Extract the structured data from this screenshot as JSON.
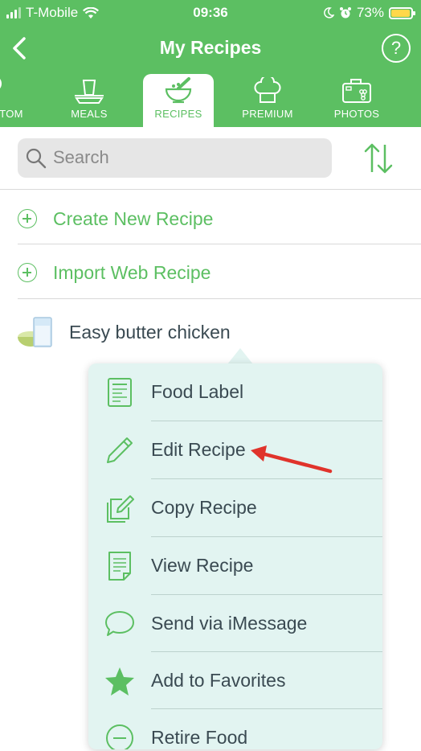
{
  "status_bar": {
    "carrier": "T-Mobile",
    "time": "09:36",
    "battery_percent": "73%"
  },
  "nav": {
    "title": "My Recipes",
    "help_label": "?"
  },
  "tabs": [
    {
      "label": "TOM",
      "icon": "spoon-icon",
      "active": false
    },
    {
      "label": "MEALS",
      "icon": "meals-icon",
      "active": false
    },
    {
      "label": "RECIPES",
      "icon": "mortar-pestle-icon",
      "active": true
    },
    {
      "label": "PREMIUM",
      "icon": "chef-hat-icon",
      "active": false
    },
    {
      "label": "PHOTOS",
      "icon": "camera-grapes-icon",
      "active": false
    }
  ],
  "search": {
    "placeholder": "Search"
  },
  "actions": {
    "create": "Create New Recipe",
    "import": "Import Web Recipe"
  },
  "recipe": {
    "name": "Easy butter chicken"
  },
  "menu": {
    "items": [
      {
        "label": "Food Label",
        "icon": "food-label-icon"
      },
      {
        "label": "Edit Recipe",
        "icon": "pencil-icon"
      },
      {
        "label": "Copy Recipe",
        "icon": "copy-edit-icon"
      },
      {
        "label": "View Recipe",
        "icon": "document-icon"
      },
      {
        "label": "Send via iMessage",
        "icon": "chat-bubble-icon"
      },
      {
        "label": "Add to Favorites",
        "icon": "star-icon"
      },
      {
        "label": "Retire Food",
        "icon": "minus-circle-icon"
      }
    ]
  },
  "colors": {
    "brand_green": "#5cbf62",
    "popup_bg": "#e2f4f1",
    "annotation_red": "#e0332b"
  }
}
